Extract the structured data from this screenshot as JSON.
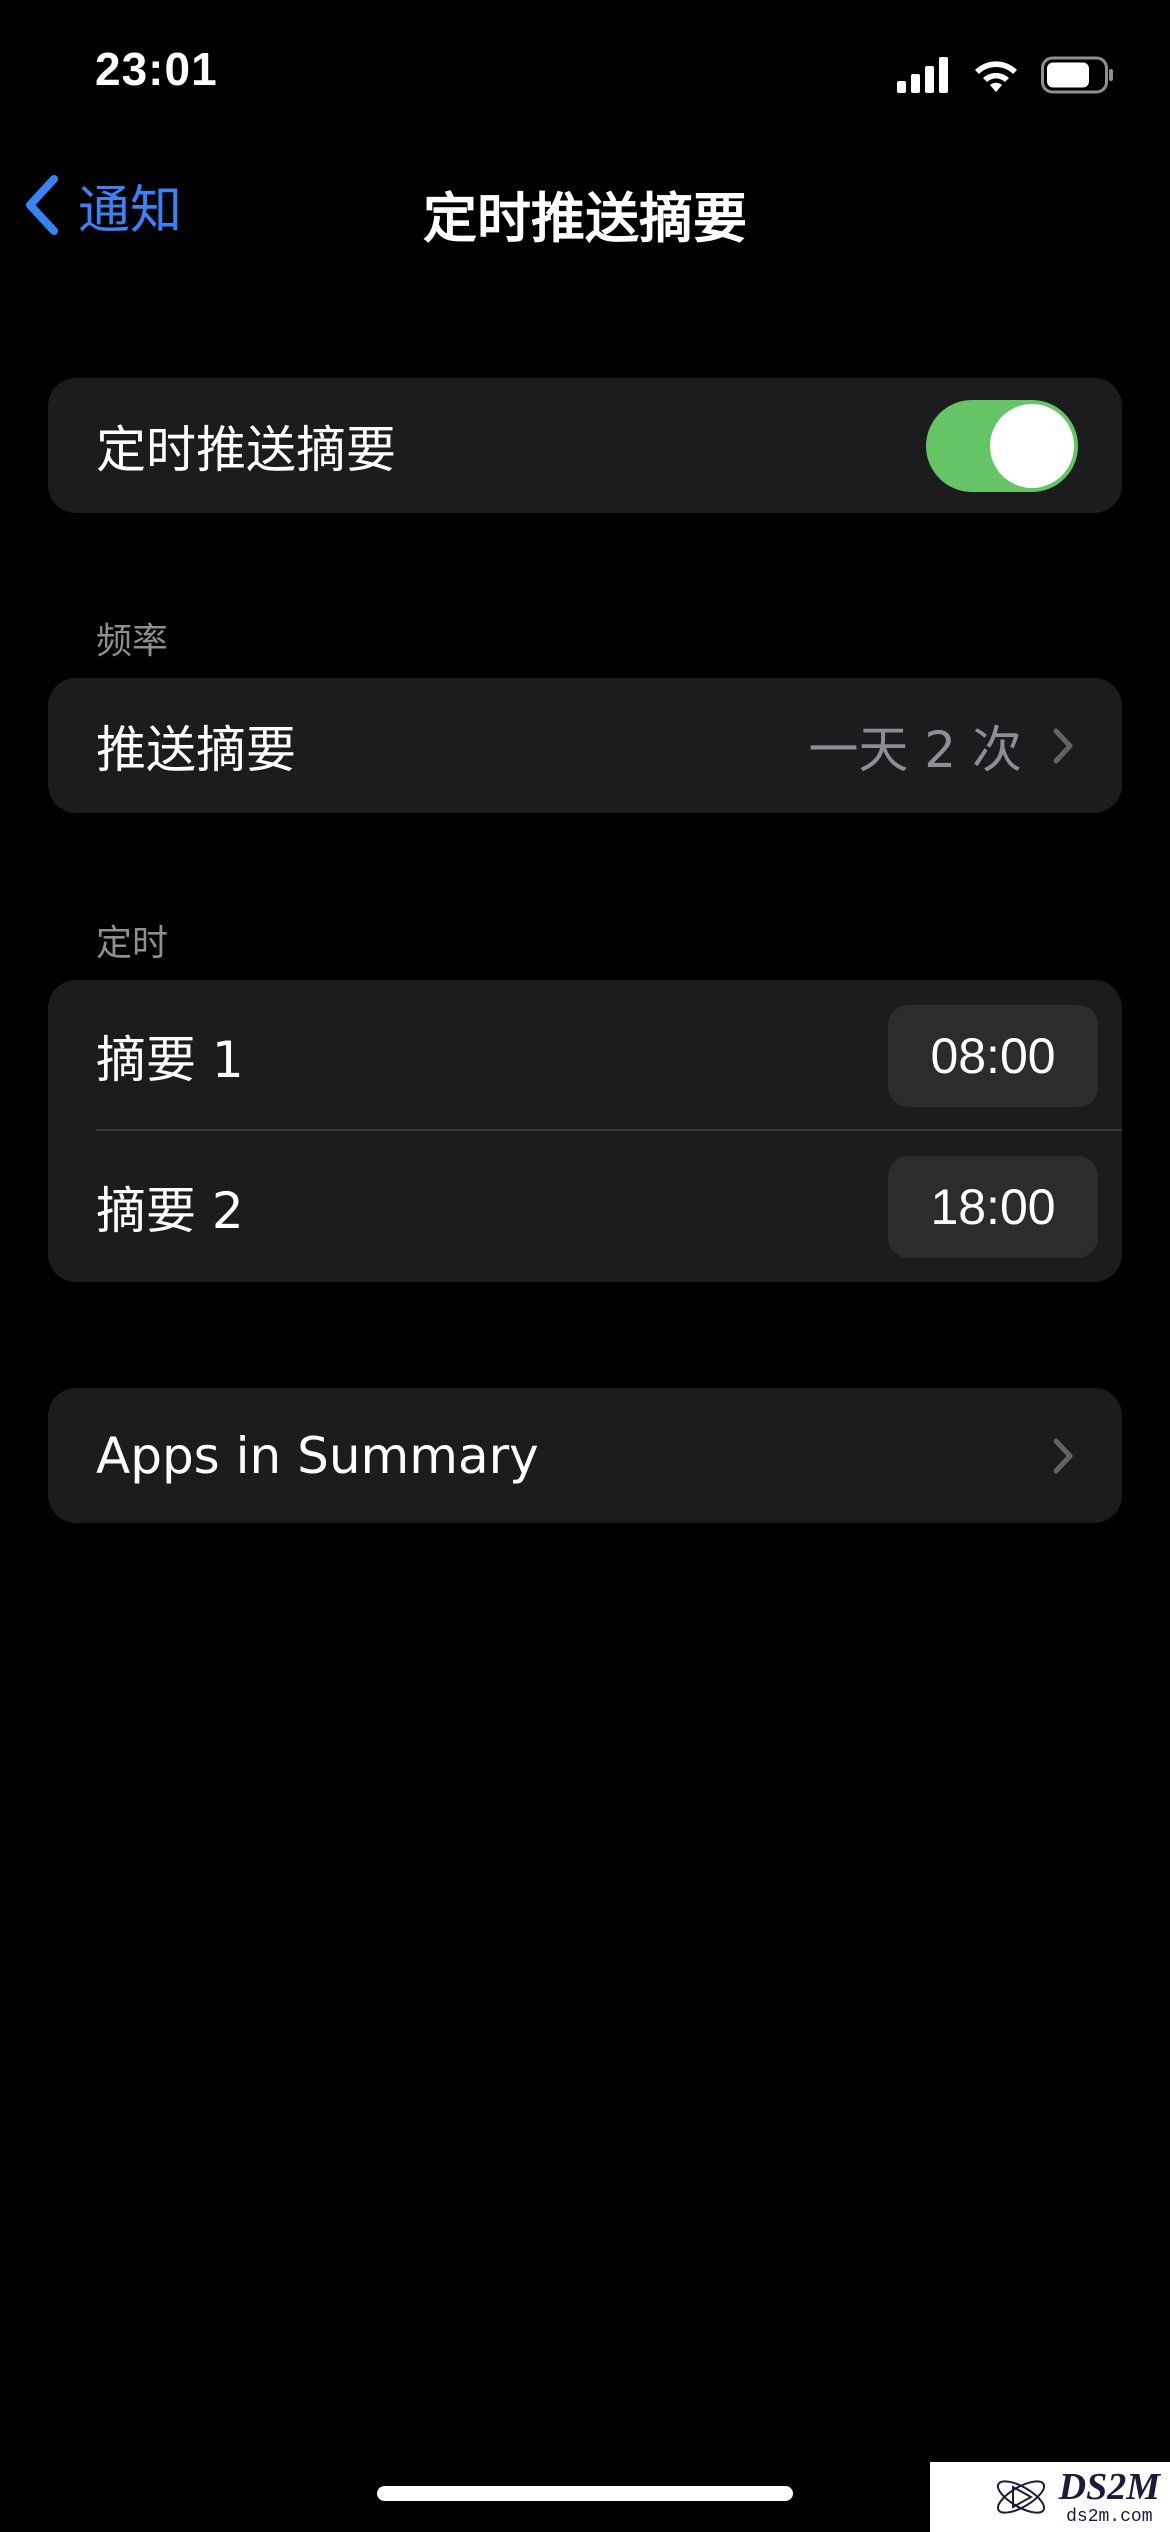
{
  "status_bar": {
    "time": "23:01",
    "icons": [
      "signal-icon",
      "wifi-icon",
      "battery-icon"
    ],
    "battery_level": 0.75
  },
  "nav": {
    "back_label": "通知",
    "title": "定时推送摘要"
  },
  "toggle_group": {
    "label": "定时推送摘要",
    "enabled": true,
    "on_color": "#65c466"
  },
  "frequency": {
    "header": "频率",
    "row_label": "推送摘要",
    "row_value": "一天 2 次"
  },
  "schedule": {
    "header": "定时",
    "items": [
      {
        "label": "摘要 1",
        "time": "08:00"
      },
      {
        "label": "摘要 2",
        "time": "18:00"
      }
    ]
  },
  "apps": {
    "label": "Apps in Summary"
  },
  "watermark": {
    "main": "DS2M",
    "sub": "ds2m.com"
  },
  "colors": {
    "accent": "#3a82f7",
    "background": "#000000",
    "cell": "#1c1c1e",
    "secondary_text": "#8e8e93"
  }
}
